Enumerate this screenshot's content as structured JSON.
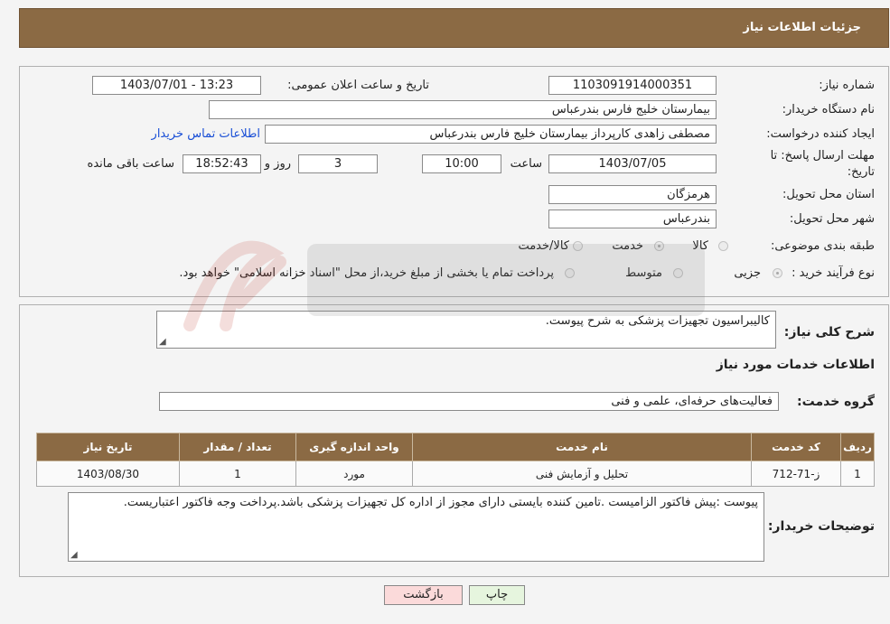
{
  "header": {
    "title": "جزئیات اطلاعات نیاز"
  },
  "form": {
    "need_number_label": "شماره نیاز:",
    "need_number": "1103091914000351",
    "announce_label": "تاریخ و ساعت اعلان عمومی:",
    "announce_value": "1403/07/01 - 13:23",
    "buyer_label": "نام دستگاه خریدار:",
    "buyer_value": "بیمارستان خلیج فارس بندرعباس",
    "creator_label": "ایجاد کننده درخواست:",
    "creator_value": "مصطفی زاهدی کارپرداز بیمارستان خلیج فارس بندرعباس",
    "contact_link": "اطلاعات تماس خریدار",
    "deadline_label": "مهلت ارسال پاسخ: تا تاریخ:",
    "deadline_date": "1403/07/05",
    "time_label": "ساعت",
    "deadline_time": "10:00",
    "days_value": "3",
    "days_label": "روز و",
    "remaining_time": "18:52:43",
    "remaining_label": "ساعت باقی مانده",
    "province_label": "استان محل تحویل:",
    "province_value": "هرمزگان",
    "city_label": "شهر محل تحویل:",
    "city_value": "بندرعباس",
    "category_label": "طبقه بندی موضوعی:",
    "category_options": [
      "کالا",
      "خدمت",
      "کالا/خدمت"
    ],
    "category_selected": "خدمت",
    "process_label": "نوع فرآیند خرید :",
    "process_options": [
      "جزیی",
      "متوسط"
    ],
    "process_note": "پرداخت تمام یا بخشی از مبلغ خرید،از محل \"اسناد خزانه اسلامی\" خواهد بود."
  },
  "details": {
    "summary_label": "شرح کلی نیاز:",
    "summary_value": "کالیبراسیون تجهیزات پزشکی به شرح پیوست.",
    "services_title": "اطلاعات خدمات مورد نیاز",
    "group_label": "گروه خدمت:",
    "group_value": "فعالیت‌های حرفه‌ای، علمی و فنی",
    "table_headers": [
      "ردیف",
      "کد خدمت",
      "نام خدمت",
      "واحد اندازه گیری",
      "تعداد / مقدار",
      "تاریخ نیاز"
    ],
    "table_rows": [
      [
        "1",
        "ز-71-712",
        "تحلیل و آزمایش فنی",
        "مورد",
        "1",
        "1403/08/30"
      ]
    ],
    "buyer_notes_label": "توضیحات خریدار:",
    "buyer_notes_value": "پیوست :پیش فاکتور الزامیست .تامین کننده بایستی دارای مجوز از اداره کل تجهیزات پزشکی باشد.پرداخت وجه فاکتور اعتباریست."
  },
  "buttons": {
    "print": "چاپ",
    "back": "بازگشت"
  },
  "colors": {
    "header_bg": "#8b6a44",
    "link": "#1a4fd6",
    "back_bg": "#fbdada",
    "print_bg": "#e6f5de"
  }
}
